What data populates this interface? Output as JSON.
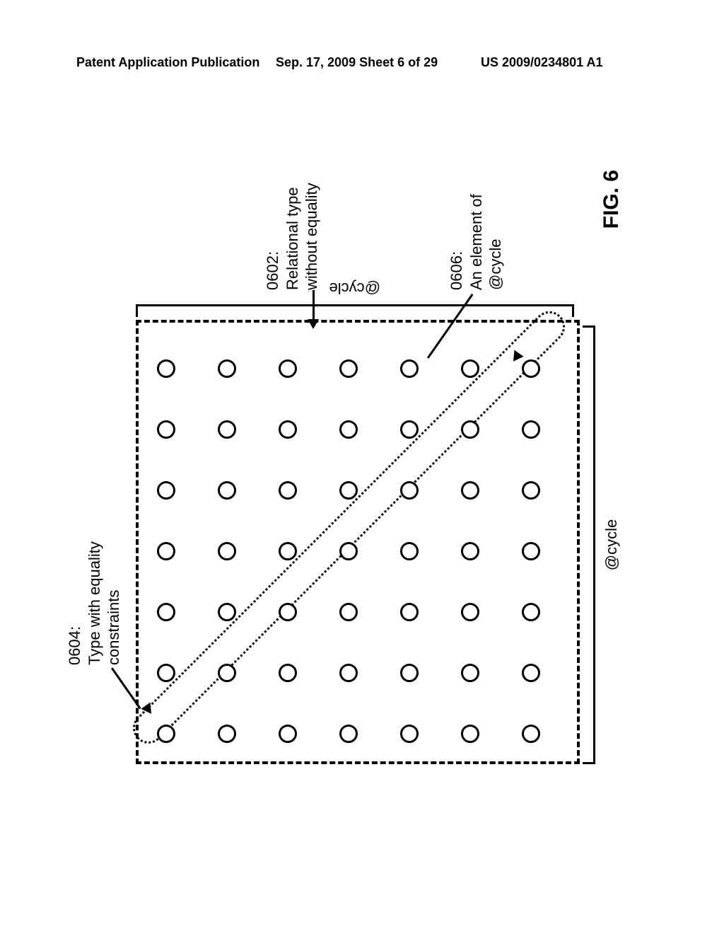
{
  "header": {
    "left": "Patent Application Publication",
    "center": "Sep. 17, 2009  Sheet 6 of 29",
    "right": "US 2009/0234801 A1"
  },
  "figure": {
    "axis_x": "@cycle",
    "axis_y": "@cycle",
    "caption": "FIG. 6",
    "grid": {
      "rows": 7,
      "cols": 7
    },
    "callouts": {
      "c0604": {
        "id": "0604:",
        "text": "Type with equality constraints"
      },
      "c0602": {
        "id": "0602:",
        "text": "Relational type without equality"
      },
      "c0606": {
        "id": "0606:",
        "text": "An element of @cycle"
      }
    }
  }
}
